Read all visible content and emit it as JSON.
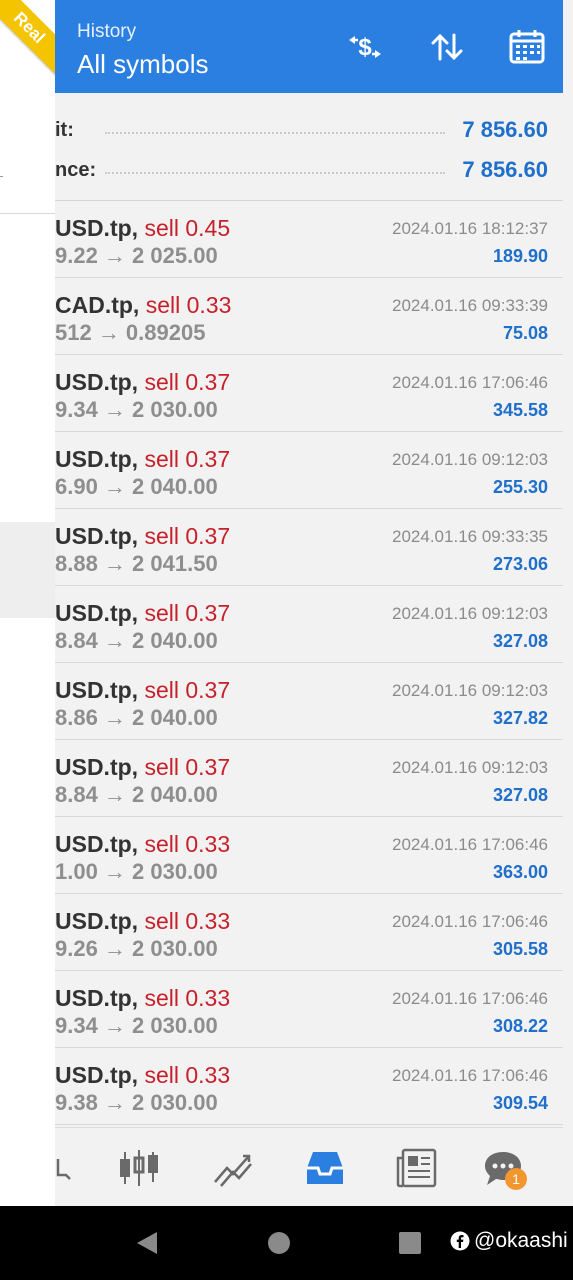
{
  "badge": {
    "label": "Real"
  },
  "header": {
    "title": "History",
    "subtitle": "All symbols",
    "icons": [
      "currency-filter-icon",
      "sort-icon",
      "calendar-icon"
    ]
  },
  "summary": {
    "rows": [
      {
        "label": "it:",
        "value": "7 856.60"
      },
      {
        "label": "nce:",
        "value": "7 856.60"
      }
    ]
  },
  "deals": [
    {
      "symbol": "USD.tp,",
      "side": "sell 0.45",
      "prices": "9.22 → 2 025.00",
      "time": "2024.01.16 18:12:37",
      "profit": "189.90"
    },
    {
      "symbol": "CAD.tp,",
      "side": "sell 0.33",
      "prices": "512 → 0.89205",
      "time": "2024.01.16 09:33:39",
      "profit": "75.08"
    },
    {
      "symbol": "USD.tp,",
      "side": "sell 0.37",
      "prices": "9.34 → 2 030.00",
      "time": "2024.01.16 17:06:46",
      "profit": "345.58"
    },
    {
      "symbol": "USD.tp,",
      "side": "sell 0.37",
      "prices": "6.90 → 2 040.00",
      "time": "2024.01.16 09:12:03",
      "profit": "255.30"
    },
    {
      "symbol": "USD.tp,",
      "side": "sell 0.37",
      "prices": "8.88 → 2 041.50",
      "time": "2024.01.16 09:33:35",
      "profit": "273.06"
    },
    {
      "symbol": "USD.tp,",
      "side": "sell 0.37",
      "prices": "8.84 → 2 040.00",
      "time": "2024.01.16 09:12:03",
      "profit": "327.08"
    },
    {
      "symbol": "USD.tp,",
      "side": "sell 0.37",
      "prices": "8.86 → 2 040.00",
      "time": "2024.01.16 09:12:03",
      "profit": "327.82"
    },
    {
      "symbol": "USD.tp,",
      "side": "sell 0.37",
      "prices": "8.84 → 2 040.00",
      "time": "2024.01.16 09:12:03",
      "profit": "327.08"
    },
    {
      "symbol": "USD.tp,",
      "side": "sell 0.33",
      "prices": "1.00 → 2 030.00",
      "time": "2024.01.16 17:06:46",
      "profit": "363.00"
    },
    {
      "symbol": "USD.tp,",
      "side": "sell 0.33",
      "prices": "9.26 → 2 030.00",
      "time": "2024.01.16 17:06:46",
      "profit": "305.58"
    },
    {
      "symbol": "USD.tp,",
      "side": "sell 0.33",
      "prices": "9.34 → 2 030.00",
      "time": "2024.01.16 17:06:46",
      "profit": "308.22"
    },
    {
      "symbol": "USD.tp,",
      "side": "sell 0.33",
      "prices": "9.38 → 2 030.00",
      "time": "2024.01.16 17:06:46",
      "profit": "309.54"
    }
  ],
  "tabbar": {
    "tabs": [
      "quotes-icon",
      "chart-icon",
      "trade-icon",
      "history-icon",
      "news-icon",
      "chat-icon"
    ],
    "active": "history-icon",
    "chat_badge": "1"
  },
  "navbar": {
    "watermark": "@okaashi"
  },
  "colors": {
    "accent": "#2a7fe0",
    "sell": "#c8202a",
    "profit": "#1f6fcb",
    "badge": "#f5c400"
  }
}
